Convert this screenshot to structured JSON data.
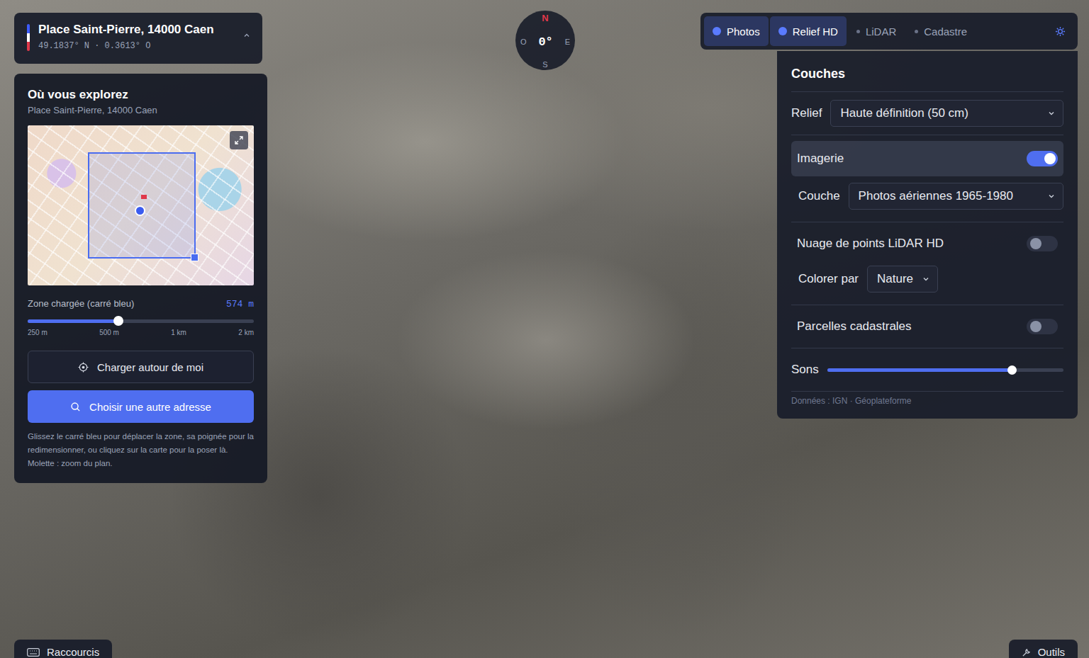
{
  "location": {
    "title": "Place Saint-Pierre, 14000 Caen",
    "coords": "49.1837° N · 0.3613° O",
    "expanded": true
  },
  "compass": {
    "north": "N",
    "west": "O",
    "east": "E",
    "south": "S",
    "heading": "0°"
  },
  "explore": {
    "title": "Où vous explorez",
    "subtitle": "Place Saint-Pierre, 14000 Caen",
    "zone_label": "Zone chargée (carré bleu)",
    "zone_value": "574 m",
    "zone_level": 0.4,
    "ticks": [
      "250 m",
      "500 m",
      "1 km",
      "2 km"
    ],
    "locate_button": "Charger autour de moi",
    "search_button": "Choisir une autre adresse",
    "hint": "Glissez le carré bleu pour déplacer la zone, sa poignée pour la redimensionner, ou cliquez sur la carte pour la poser là. Molette : zoom du plan."
  },
  "toolbar": {
    "tabs": [
      {
        "label": "Photos",
        "on": true
      },
      {
        "label": "Relief HD",
        "on": true
      },
      {
        "label": "LiDAR",
        "on": false
      },
      {
        "label": "Cadastre",
        "on": false
      }
    ]
  },
  "layers": {
    "title": "Couches",
    "groups": [
      [
        {
          "kind": "select",
          "label": "Relief",
          "value": "Haute définition (50 cm)",
          "sub": false,
          "highlighted": false
        }
      ],
      [
        {
          "kind": "toggle",
          "label": "Imagerie",
          "on": true,
          "sub": false,
          "highlighted": true
        },
        {
          "kind": "select",
          "label": "Couche",
          "value": "Photos aériennes 1965-1980",
          "sub": true,
          "highlighted": false
        }
      ],
      [
        {
          "kind": "toggle",
          "label": "Nuage de points LiDAR HD",
          "on": false,
          "sub": false,
          "highlighted": false
        },
        {
          "kind": "select",
          "label": "Colorer par",
          "value": "Nature",
          "sub": true,
          "highlighted": false
        }
      ],
      [
        {
          "kind": "toggle",
          "label": "Parcelles cadastrales",
          "on": false,
          "sub": false,
          "highlighted": false
        }
      ],
      [
        {
          "kind": "slider",
          "label": "Sons",
          "level": 0.78,
          "sub": false,
          "highlighted": false
        }
      ]
    ],
    "source": "Données : IGN · Géoplateforme"
  },
  "footer": {
    "left": "Raccourcis",
    "right": "Outils"
  }
}
